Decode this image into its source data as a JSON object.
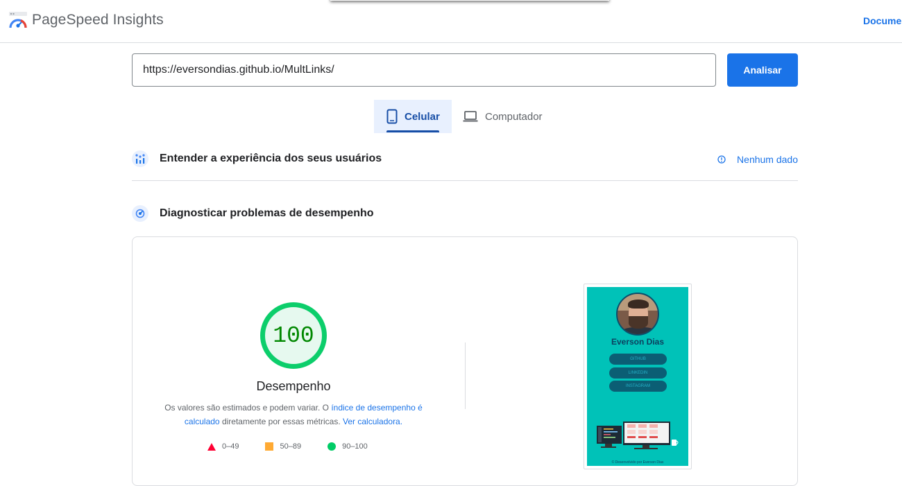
{
  "header": {
    "app_name": "PageSpeed Insights",
    "docs_link": "Docume"
  },
  "search": {
    "url_value": "https://eversondias.github.io/MultLinks/",
    "analyze_label": "Analisar"
  },
  "tabs": [
    {
      "label": "Celular",
      "icon": "smartphone-icon",
      "selected": true
    },
    {
      "label": "Computador",
      "icon": "laptop-icon",
      "selected": false
    }
  ],
  "ux_section": {
    "title": "Entender a experiência dos seus usuários",
    "icon": "users-chart-icon",
    "status_label": "Nenhum dado",
    "status_icon": "info-icon"
  },
  "perf_section": {
    "title": "Diagnosticar problemas de desempenho",
    "icon": "speedometer-icon"
  },
  "performance": {
    "score": "100",
    "score_value": 100,
    "label": "Desempenho",
    "desc_part1": "Os valores são estimados e podem variar. O ",
    "desc_link1": "índice de desempenho é calculado",
    "desc_part2": " diretamente por essas métricas. ",
    "desc_link2": "Ver calculadora.",
    "legend": [
      {
        "range": "0–49",
        "shape": "triangle",
        "color": "#ff0033"
      },
      {
        "range": "50–89",
        "shape": "square",
        "color": "#ffaa33"
      },
      {
        "range": "90–100",
        "shape": "circle",
        "color": "#00cc66"
      }
    ],
    "colors": {
      "pass": "#0cce6b",
      "pass_fill": "#e6f9ef",
      "pass_text": "#008800"
    }
  },
  "screenshot": {
    "name": "Everson Dias",
    "buttons": [
      "GITHUB",
      "LINKEDIN",
      "INSTAGRAM"
    ],
    "footer": "© Desenvolvido por Everson Dias",
    "background": "#00c2b8"
  }
}
